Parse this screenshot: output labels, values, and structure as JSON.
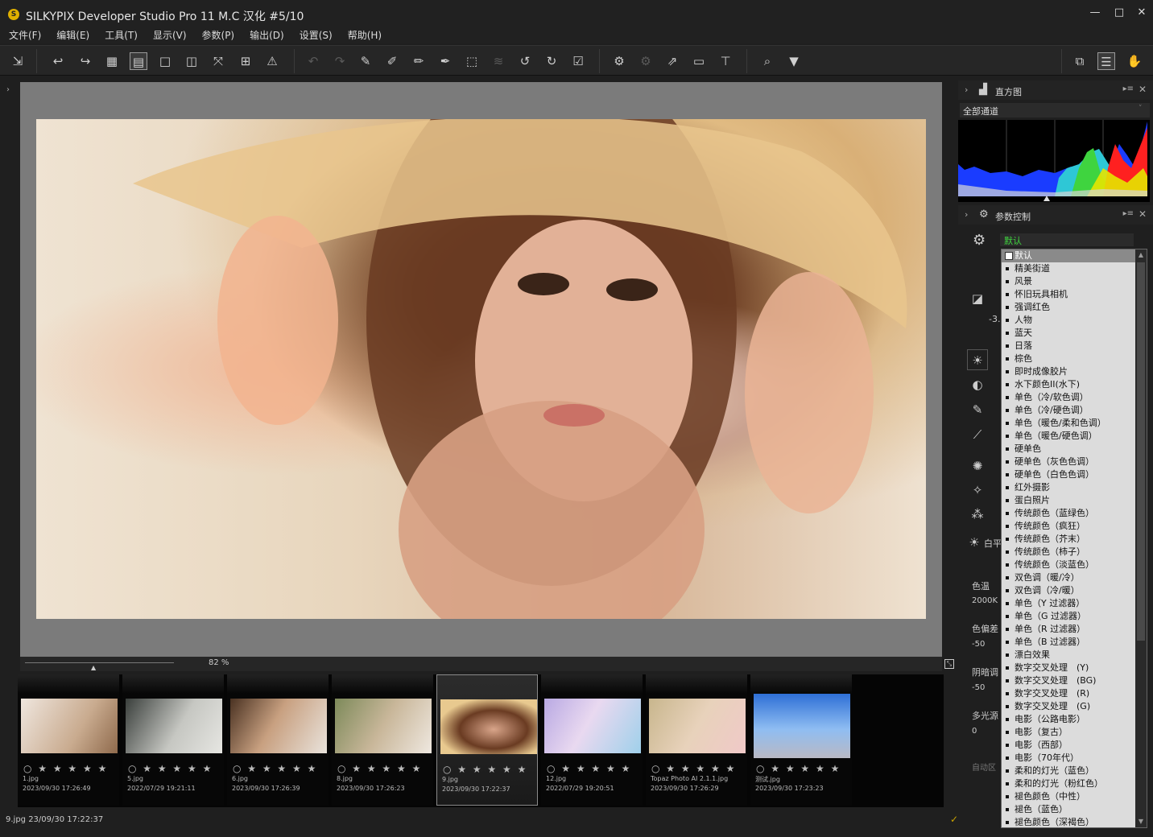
{
  "window": {
    "title": "SILKYPIX Developer Studio Pro 11 M.C 汉化   #5/10",
    "minimize": "—",
    "maximize": "□",
    "close": "✕"
  },
  "menu": [
    "文件(F)",
    "编辑(E)",
    "工具(T)",
    "显示(V)",
    "参数(P)",
    "输出(D)",
    "设置(S)",
    "帮助(H)"
  ],
  "zoom": {
    "value": "82",
    "unit": "%"
  },
  "filmstrip": [
    {
      "name": "1.jpg",
      "date": "2023/09/30 17:26:49",
      "stars": "○ ★ ★ ★ ★ ★"
    },
    {
      "name": "5.jpg",
      "date": "2022/07/29 19:21:11",
      "stars": "○ ★ ★ ★ ★ ★"
    },
    {
      "name": "6.jpg",
      "date": "2023/09/30 17:26:39",
      "stars": "○ ★ ★ ★ ★ ★"
    },
    {
      "name": "8.jpg",
      "date": "2023/09/30 17:26:23",
      "stars": "○ ★ ★ ★ ★ ★"
    },
    {
      "name": "9.jpg",
      "date": "2023/09/30 17:22:37",
      "stars": "○ ★ ★ ★ ★ ★"
    },
    {
      "name": "12.jpg",
      "date": "2022/07/29 19:20:51",
      "stars": "○ ★ ★ ★ ★ ★"
    },
    {
      "name": "Topaz Photo AI 2.1.1.jpg",
      "date": "2023/09/30 17:26:29",
      "stars": "○ ★ ★ ★ ★ ★"
    },
    {
      "name": "测试.jpg",
      "date": "2023/09/30 17:23:23",
      "stars": "○ ★ ★ ★ ★ ★"
    }
  ],
  "status": "9.jpg 23/09/30 17:22:37",
  "histogram": {
    "title": "直方图",
    "channel": "全部通道"
  },
  "params": {
    "title": "参数控制",
    "preset_selected": "默认",
    "partial_labels": [
      "-3.",
      "白平",
      "色温",
      "2000K",
      "色偏差",
      "-50",
      "阴暗调",
      "-50",
      "多光源",
      "0",
      "自动区"
    ]
  },
  "preset_list": [
    "默认",
    "精美街道",
    "风景",
    "怀旧玩具相机",
    "强调红色",
    "人物",
    "蓝天",
    "日落",
    "棕色",
    "即时成像胶片",
    "水下颜色II(水下)",
    "单色（冷/软色调）",
    "单色（冷/硬色调）",
    "单色（暖色/柔和色调）",
    "单色（暖色/硬色调）",
    "硬单色",
    "硬单色（灰色色调）",
    "硬单色（白色色调）",
    "红外摄影",
    "蛋白照片",
    "传统颜色（蓝绿色）",
    "传统颜色（疯狂）",
    "传统颜色（芥末）",
    "传统颜色（柿子）",
    "传统颜色（淡蓝色）",
    "双色调（暖/冷）",
    "双色调（冷/暖）",
    "单色（Y 过滤器）",
    "单色（G 过滤器）",
    "单色（R 过滤器）",
    "单色（B 过滤器）",
    "漂白效果",
    "数字交叉处理　(Y)",
    "数字交叉处理　(BG)",
    "数字交叉处理　(R)",
    "数字交叉处理　(G)",
    "电影（公路电影）",
    "电影（复古）",
    "电影（西部）",
    "电影（70年代）",
    "柔和的灯光（蓝色）",
    "柔和的灯光（粉红色）",
    "褪色颜色（中性）",
    "褪色（蓝色）",
    "褪色颜色（深褐色）"
  ]
}
